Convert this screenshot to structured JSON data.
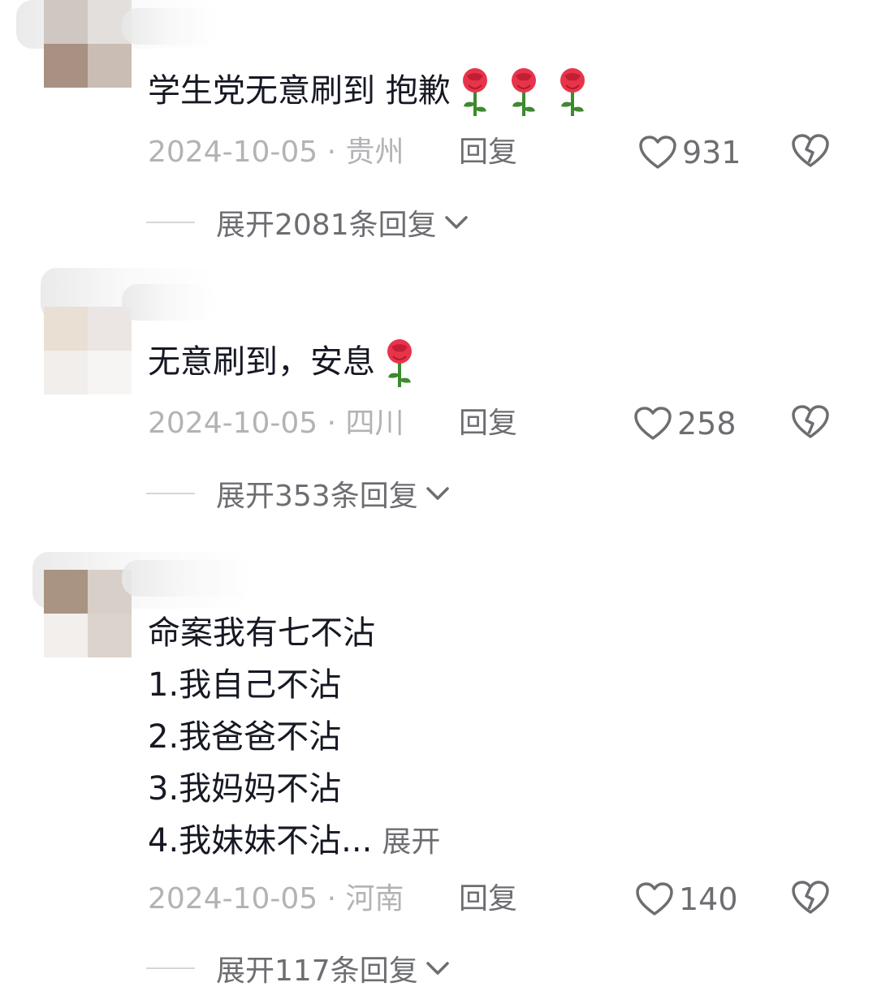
{
  "comments": [
    {
      "text": "学生党无意刷到 抱歉",
      "emoji": "rose-icon x3",
      "date": "2024-10-05 · 贵州",
      "reply_label": "回复",
      "likes": "931",
      "expand_replies": "展开2081条回复"
    },
    {
      "text": "无意刷到，安息",
      "emoji": "rose-icon x1",
      "date": "2024-10-05 · 四川",
      "reply_label": "回复",
      "likes": "258",
      "expand_replies": "展开353条回复"
    },
    {
      "lines": [
        "命案我有七不沾",
        "1.我自己不沾",
        "2.我爸爸不沾",
        "3.我妈妈不沾",
        "4.我妹妹不沾..."
      ],
      "expand_text": "展开",
      "date": "2024-10-05 · 河南",
      "reply_label": "回复",
      "likes": "140",
      "expand_replies": "展开117条回复"
    }
  ],
  "colors": {
    "text": "#161823",
    "meta": "#b3b3b6",
    "secondary": "#6d6e72",
    "rose": "#e8344a",
    "stem": "#3d8a2f"
  }
}
